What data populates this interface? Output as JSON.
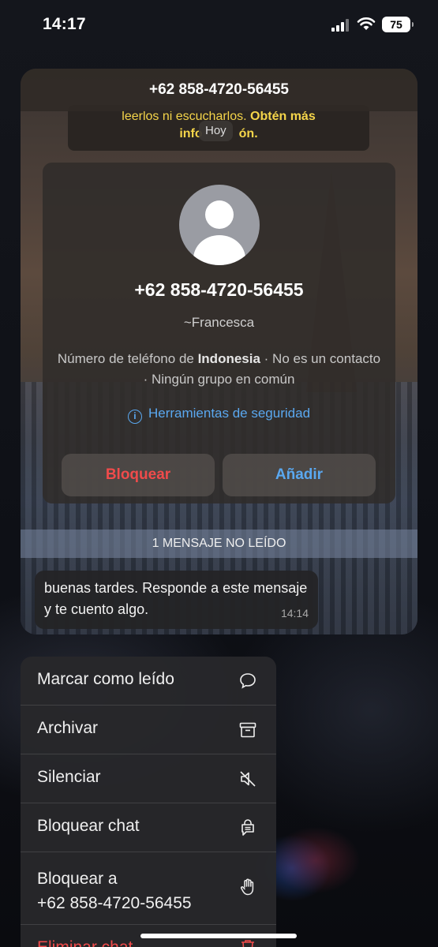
{
  "status_bar": {
    "time": "14:17",
    "battery": "75"
  },
  "chat_preview": {
    "header_title": "+62 858-4720-56455",
    "encryption_notice_line1": "leerlos ni escucharlos.",
    "encryption_notice_link": "Obtén más",
    "encryption_notice_line2_a": "info",
    "encryption_notice_line2_b": "ón.",
    "date_label": "Hoy",
    "contact_card": {
      "phone_number": "+62 858-4720-56455",
      "push_name": "~Francesca",
      "info_prefix": "Número de teléfono de ",
      "country": "Indonesia",
      "info_suffix": " · No es un contacto · Ningún grupo en común",
      "security_tools": "Herramientas de seguridad",
      "block_label": "Bloquear",
      "add_label": "Añadir"
    },
    "unread_banner": "1 MENSAJE NO LEÍDO",
    "message": {
      "text": "buenas tardes. Responde a este mensaje y te cuento algo.",
      "time": "14:14"
    }
  },
  "context_menu": {
    "items": [
      {
        "label": "Marcar como leído",
        "icon": "chat-bubble-icon"
      },
      {
        "label": "Archivar",
        "icon": "archive-box-icon"
      },
      {
        "label": "Silenciar",
        "icon": "speaker-muted-icon"
      },
      {
        "label": "Bloquear chat",
        "icon": "locked-chat-icon"
      },
      {
        "label": "Bloquear a\n+62 858-4720-56455",
        "icon": "raised-hand-icon"
      },
      {
        "label": "Eliminar chat",
        "icon": "trash-icon",
        "color": "#f04b4b"
      }
    ]
  },
  "colors": {
    "accent_blue": "#5aa8f0",
    "danger_red": "#f04b4b",
    "notice_yellow": "#f5d54a"
  }
}
